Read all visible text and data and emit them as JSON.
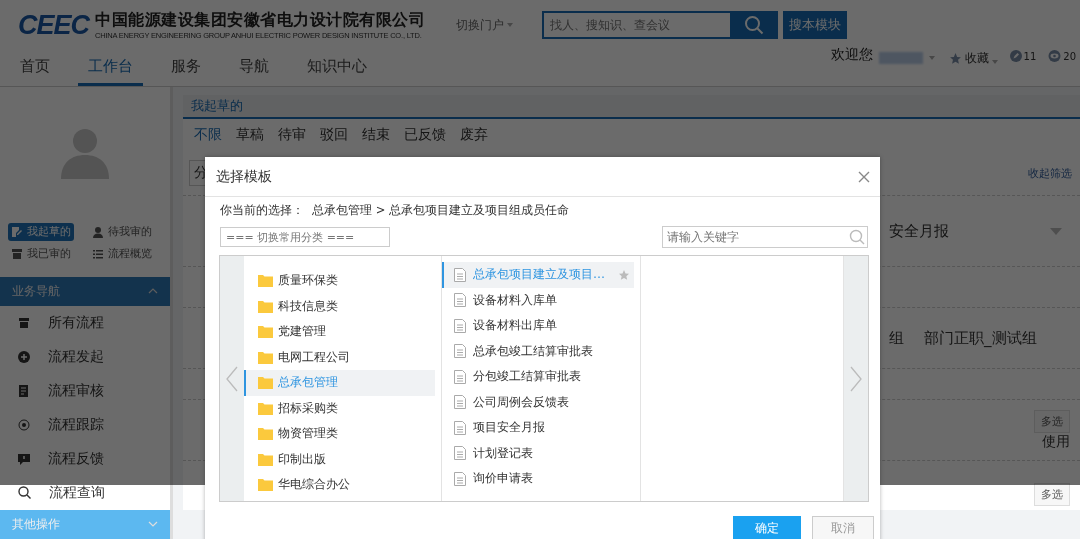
{
  "header": {
    "logo": "CEEC",
    "company_name": "中国能源建设集团安徽省电力设计院有限公司",
    "company_name_en": "CHINA ENERGY ENGINEERING GROUP ANHUI ELECTRIC POWER DESIGN INSTITUTE CO., LTD.",
    "portal_switch": {
      "label": "切换门户",
      "expanded": false
    },
    "search": {
      "placeholder": "找人、搜知识、查会议"
    },
    "module_search_button": "搜本模块"
  },
  "nav": {
    "tabs": [
      {
        "label": "首页",
        "selected": false
      },
      {
        "label": "工作台",
        "selected": true
      },
      {
        "label": "服务",
        "selected": false
      },
      {
        "label": "导航",
        "selected": false
      },
      {
        "label": "知识中心",
        "selected": false
      }
    ],
    "welcome": "欢迎您",
    "favorites": "收藏",
    "counters": [
      {
        "kind": "check",
        "count": "11"
      },
      {
        "kind": "eye",
        "count": "20"
      }
    ]
  },
  "sidebar": {
    "quick_links": [
      {
        "label": "我起草的",
        "kind": "draft",
        "selected": true
      },
      {
        "label": "待我审的",
        "kind": "pending",
        "selected": false
      },
      {
        "label": "我已审的",
        "kind": "reviewed",
        "selected": false
      },
      {
        "label": "流程概览",
        "kind": "overview",
        "selected": false
      }
    ],
    "sections": [
      {
        "title": "业务导航",
        "expanded": true,
        "items": [
          {
            "label": "所有流程",
            "kind": "all"
          },
          {
            "label": "流程发起",
            "kind": "start"
          },
          {
            "label": "流程审核",
            "kind": "review"
          },
          {
            "label": "流程跟踪",
            "kind": "track"
          },
          {
            "label": "流程反馈",
            "kind": "feedback"
          },
          {
            "label": "流程查询",
            "kind": "query"
          }
        ]
      },
      {
        "title": "其他操作",
        "expanded": false
      }
    ]
  },
  "main": {
    "title": "我起草的",
    "status_tabs": [
      {
        "label": "不限",
        "selected": true
      },
      {
        "label": "草稿",
        "selected": false
      },
      {
        "label": "待审",
        "selected": false
      },
      {
        "label": "驳回",
        "selected": false
      },
      {
        "label": "结束",
        "selected": false
      },
      {
        "label": "已反馈",
        "selected": false
      },
      {
        "label": "废弃",
        "selected": false
      }
    ],
    "category_partial": "分",
    "collapse_link": "收起筛选",
    "template_value": "安全月报",
    "group_partial": "组",
    "group_value": "部门正职_测试组",
    "multi_select_buttons": [
      "多选",
      "多选"
    ],
    "use_label": "使用"
  },
  "modal": {
    "title": "选择模板",
    "current_selection_label": "你当前的选择：",
    "current_selection_path": "总承包管理 > 总承包项目建立及项目组成员任命",
    "category_switch": {
      "placeholder": "=== 切换常用分类 ==="
    },
    "keyword_search": {
      "placeholder": "请输入关键字"
    },
    "categories": [
      {
        "label": "质量环保类",
        "selected": false
      },
      {
        "label": "科技信息类",
        "selected": false
      },
      {
        "label": "党建管理",
        "selected": false
      },
      {
        "label": "电网工程公司",
        "selected": false
      },
      {
        "label": "总承包管理",
        "selected": true
      },
      {
        "label": "招标采购类",
        "selected": false
      },
      {
        "label": "物资管理类",
        "selected": false
      },
      {
        "label": "印制出版",
        "selected": false
      },
      {
        "label": "华电综合办公",
        "selected": false
      }
    ],
    "templates": [
      {
        "label": "总承包项目建立及项目…",
        "selected": true
      },
      {
        "label": "设备材料入库单",
        "selected": false
      },
      {
        "label": "设备材料出库单",
        "selected": false
      },
      {
        "label": "总承包竣工结算审批表",
        "selected": false
      },
      {
        "label": "分包竣工结算审批表",
        "selected": false
      },
      {
        "label": "公司周例会反馈表",
        "selected": false
      },
      {
        "label": "项目安全月报",
        "selected": false
      },
      {
        "label": "计划登记表",
        "selected": false
      },
      {
        "label": "询价申请表",
        "selected": false
      }
    ],
    "confirm_button": "确定",
    "cancel_button": "取消"
  }
}
